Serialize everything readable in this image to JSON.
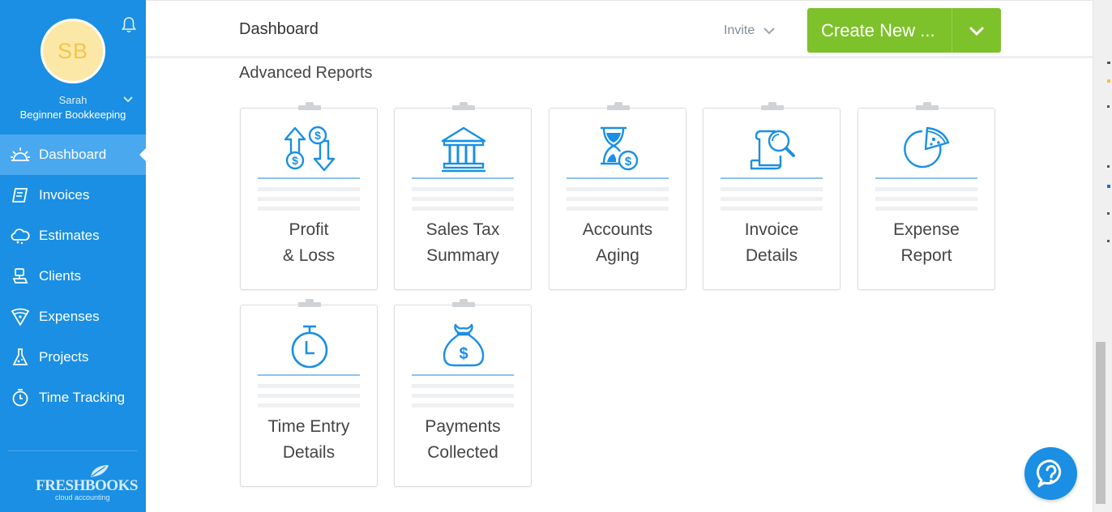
{
  "sidebar": {
    "avatar_initials": "SB",
    "user_name": "Sarah",
    "user_org": "Beginner Bookkeeping",
    "nav": [
      {
        "label": "Dashboard",
        "icon": "dashboard-sun-icon",
        "active": true
      },
      {
        "label": "Invoices",
        "icon": "invoice-icon"
      },
      {
        "label": "Estimates",
        "icon": "estimate-cloud-icon"
      },
      {
        "label": "Clients",
        "icon": "client-icon"
      },
      {
        "label": "Expenses",
        "icon": "expense-pizza-icon"
      },
      {
        "label": "Projects",
        "icon": "project-flask-icon"
      },
      {
        "label": "Time Tracking",
        "icon": "stopwatch-icon"
      }
    ],
    "logo": {
      "text": "FRESHBOOKS",
      "sub": "cloud accounting"
    }
  },
  "header": {
    "title": "Dashboard",
    "invite_label": "Invite",
    "create_label": "Create New ..."
  },
  "main": {
    "section_title": "Advanced Reports",
    "reports": [
      {
        "line1": "Profit",
        "line2": "& Loss",
        "icon": "profit-loss-icon"
      },
      {
        "line1": "Sales Tax",
        "line2": "Summary",
        "icon": "bank-icon"
      },
      {
        "line1": "Accounts",
        "line2": "Aging",
        "icon": "hourglass-dollar-icon"
      },
      {
        "line1": "Invoice",
        "line2": "Details",
        "icon": "document-search-icon"
      },
      {
        "line1": "Expense",
        "line2": "Report",
        "icon": "pizza-icon"
      },
      {
        "line1": "Time Entry",
        "line2": "Details",
        "icon": "stopwatch-icon"
      },
      {
        "line1": "Payments",
        "line2": "Collected",
        "icon": "money-bag-icon"
      }
    ]
  },
  "colors": {
    "sidebar": "#1a8fe3",
    "active_nav": "#4aa8ef",
    "create_button": "#7dc12b",
    "icon_blue": "#1a8fe3"
  }
}
